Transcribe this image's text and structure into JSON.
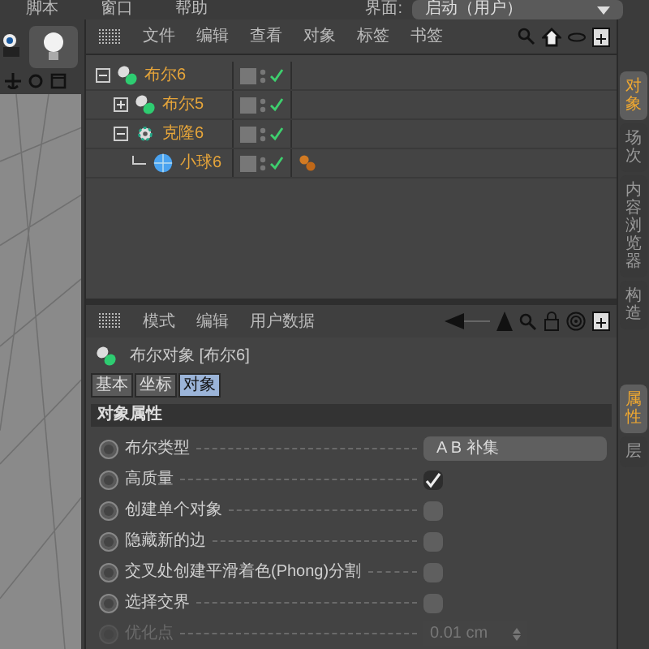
{
  "menu_bar": {
    "items": [
      "脚本",
      "窗口",
      "帮助"
    ],
    "layout_label": "界面:",
    "layout_value": "启动（用户）"
  },
  "object_manager": {
    "menu": [
      "文件",
      "编辑",
      "查看",
      "对象",
      "标签",
      "书签"
    ],
    "tree": [
      {
        "name": "布尔6",
        "kind": "boole",
        "expanded": true,
        "tag": false,
        "children": [
          {
            "name": "布尔5",
            "kind": "boole",
            "expanded": false,
            "tag": false
          },
          {
            "name": "克隆6",
            "kind": "cloner",
            "expanded": true,
            "tag": false,
            "children": [
              {
                "name": "小球6",
                "kind": "sphere",
                "tag": true
              }
            ]
          }
        ]
      }
    ]
  },
  "side_tabs_top": [
    {
      "label": "对象",
      "selected": true
    },
    {
      "label": "场次",
      "selected": false
    },
    {
      "label": "内容浏览器",
      "selected": false
    },
    {
      "label": "构造",
      "selected": false
    }
  ],
  "side_tabs_bottom": [
    {
      "label": "属性",
      "selected": true
    },
    {
      "label": "层",
      "selected": false
    }
  ],
  "attributes": {
    "menu": [
      "模式",
      "编辑",
      "用户数据"
    ],
    "title": "布尔对象 [布尔6]",
    "tabs": [
      {
        "label": "基本",
        "selected": false
      },
      {
        "label": "坐标",
        "selected": false
      },
      {
        "label": "对象",
        "selected": true
      }
    ],
    "section": "对象属性",
    "rows": [
      {
        "label": "布尔类型",
        "kind": "dropdown",
        "value": "A B 补集",
        "disabled": false
      },
      {
        "label": "高质量",
        "kind": "checkbox",
        "checked": true,
        "disabled": false
      },
      {
        "label": "创建单个对象",
        "kind": "checkbox",
        "checked": false,
        "disabled": false
      },
      {
        "label": "隐藏新的边",
        "kind": "checkbox",
        "checked": false,
        "disabled": false
      },
      {
        "label": "交叉处创建平滑着色(Phong)分割",
        "kind": "checkbox",
        "checked": false,
        "disabled": false
      },
      {
        "label": "选择交界",
        "kind": "checkbox",
        "checked": false,
        "disabled": false
      },
      {
        "label": "优化点",
        "kind": "number",
        "value": "0.01 cm",
        "disabled": true
      }
    ]
  }
}
